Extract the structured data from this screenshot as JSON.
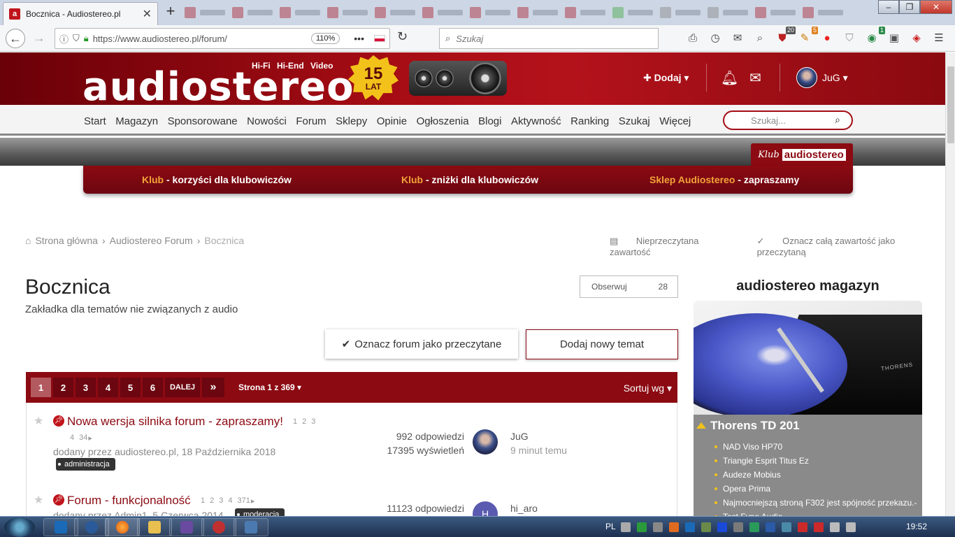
{
  "browser": {
    "tab_title": "Bocznica - Audiostereo.pl",
    "tab_favicon_letter": "a",
    "url": "https://www.audiostereo.pl/forum/",
    "zoom": "110%",
    "search_placeholder": "Szukaj",
    "toolbar_badges": {
      "badge1": "20",
      "badge2": "5",
      "badge3": "1"
    }
  },
  "header": {
    "logo": "audiostereo",
    "logo_tags": "Hi-Fi Hi-End Video",
    "anniversary_number": "15",
    "anniversary_word": "LAT",
    "add_label": "Dodaj",
    "username": "JuG"
  },
  "nav": {
    "items": [
      "Start",
      "Magazyn",
      "Sponsorowane",
      "Nowości",
      "Forum",
      "Sklepy",
      "Opinie",
      "Ogłoszenia",
      "Blogi",
      "Aktywność",
      "Ranking",
      "Szukaj",
      "Więcej"
    ],
    "search_placeholder": "Szukaj..."
  },
  "klub": {
    "tab_italic": "Klub",
    "tab_bold": "audiostereo",
    "links": [
      {
        "k": "Klub",
        "rest": " - korzyści dla klubowiczów"
      },
      {
        "k": "Klub",
        "rest": " - zniżki dla klubowiczów"
      },
      {
        "k": "Sklep Audiostereo",
        "rest": " - zapraszamy"
      }
    ]
  },
  "breadcrumb": {
    "home": "Strona główna",
    "forum": "Audiostereo Forum",
    "current": "Bocznica",
    "unread": "Nieprzeczytana zawartość",
    "mark_all": "Oznacz całą zawartość jako przeczytaną"
  },
  "forum": {
    "title": "Bocznica",
    "description": "Zakładka dla tematów nie związanych z audio",
    "follow_label": "Obserwuj",
    "follow_count": "28",
    "mark_read": "Oznacz forum jako przeczytane",
    "new_topic": "Dodaj nowy temat"
  },
  "pagination": {
    "pages": [
      "1",
      "2",
      "3",
      "4",
      "5",
      "6"
    ],
    "next": "DALEJ",
    "last": "»",
    "label": "Strona 1 z 369",
    "sort": "Sortuj wg"
  },
  "topics": [
    {
      "title": "Nowa wersja silnika forum - zapraszamy!",
      "pages_inline": [
        "1",
        "2",
        "3"
      ],
      "pages_wrap": [
        "4",
        "34"
      ],
      "meta": "dodany przez audiostereo.pl, 18 Października 2018",
      "tag": "administracja",
      "replies": "992 odpowiedzi",
      "views": "17395 wyświetleń",
      "last_user": "JuG",
      "last_time": "9 minut temu"
    },
    {
      "title": "Forum - funkcjonalność",
      "pages_inline": [
        "1",
        "2",
        "3",
        "4",
        "371"
      ],
      "pages_wrap": [],
      "meta": "dodany przez Admin1, 5 Czerwca 2014",
      "tag": "moderacja",
      "replies": "11123 odpowiedzi",
      "views": "",
      "last_user": "hi_aro",
      "last_time": "",
      "avatar_letter": "H"
    }
  ],
  "sidebar": {
    "title": "audiostereo magazyn",
    "feature": "Thorens TD 201",
    "brand_on_image": "THORENS",
    "items": [
      "NAD Viso HP70",
      "Triangle Esprit Titus Ez",
      "Audeze Mobius",
      "Opera Prima",
      "Najmocniejszą stroną F302 jest spójność przekazu.-",
      "Test Fyne Audio"
    ]
  },
  "taskbar": {
    "lang": "PL",
    "time": "19:52"
  },
  "colors": {
    "brand_red": "#8c0a12",
    "accent_orange": "#f2a33a",
    "accent_yellow": "#f2c21a"
  }
}
